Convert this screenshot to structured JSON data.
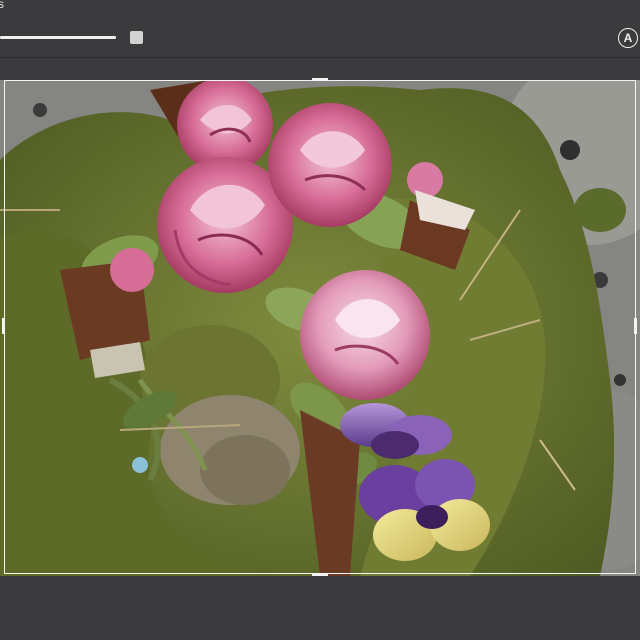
{
  "topbar": {
    "corner_label": "s",
    "slider_value": 1.0,
    "auto_label": "A"
  },
  "photo": {
    "description_icon": "photo-image",
    "colors": {
      "moss": "#657231",
      "moss_dark": "#3f4a1d",
      "stone": "#8d8c88",
      "rose": "#c95a86",
      "rose_light": "#e9a9c4",
      "pansy_purple": "#6e4a9c",
      "pansy_yellow": "#e2d77a",
      "leaf": "#7f9b4b"
    }
  },
  "icons": {
    "auto_enhance": "auto-icon",
    "slider_thumb": "slider-thumb-icon"
  }
}
